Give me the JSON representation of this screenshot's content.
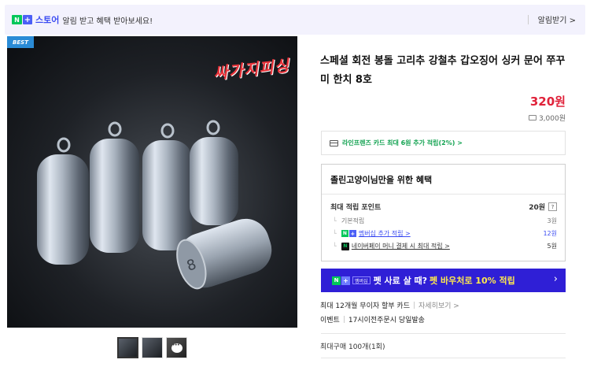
{
  "banner": {
    "store_label": "스토어",
    "promo_text": "알림 받고 혜택 받아보세요!",
    "alarm_label": "알림받기 >"
  },
  "image": {
    "best_label": "BEST",
    "brand_text": "싸가지피싱"
  },
  "product": {
    "title": "스페셜 회전 봉돌 고리추 강철추 갑오징어 싱커 문어 쭈꾸미 한치 8호",
    "price": "320원",
    "shipping": "3,000원"
  },
  "card_promo": "라인프렌즈 카드 최대 6원 추가 적립(2%) >",
  "benefits": {
    "title": "졸린고양이님만을 위한 혜택",
    "max_points_label": "최대 적립 포인트",
    "max_points_value": "20원",
    "help_label": "?",
    "rows": [
      {
        "label": "기본적립",
        "value": "3원"
      },
      {
        "label": "멤버십 추가 적립 >",
        "value": "12원"
      },
      {
        "label": "네이버페이 머니 결제 시 최대 적립 >",
        "value": "5원"
      }
    ]
  },
  "pet_banner": {
    "member_label": "멤버십",
    "text_white": "펫 사료 살 때?",
    "text_yellow": "펫 바우처로 10% 적립",
    "arrow": "›"
  },
  "info": {
    "installment": "최대 12개월 무이자 할부 카드",
    "installment_link": "자세히보기 >",
    "event_label": "이벤트",
    "event_text": "17시이전주문시 당일발송",
    "max_purchase": "최대구매 100개(1회)"
  },
  "colors": {
    "naver_green": "#03c75a",
    "brand_blue": "#3b4cf2",
    "price_red": "#e0223a",
    "pet_banner_bg": "#2f1fd6",
    "pet_highlight": "#ffe94d"
  }
}
